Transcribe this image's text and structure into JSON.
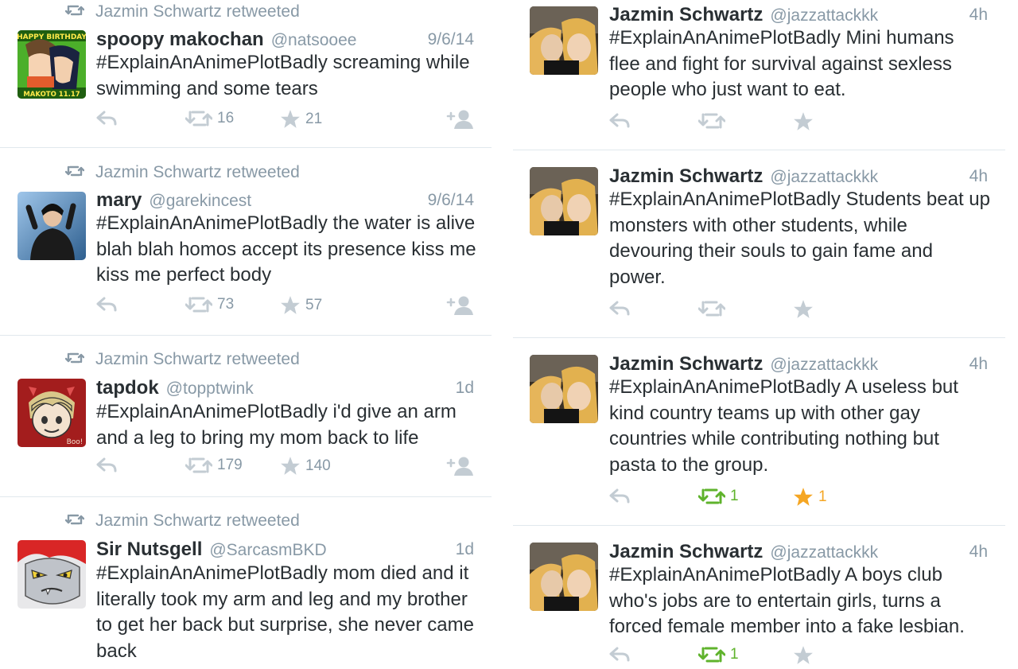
{
  "left_tweets": [
    {
      "retweeted_by": "Jazmin Schwartz retweeted",
      "name": "spoopy makochan",
      "handle": "@natsooee",
      "time": "9/6/14",
      "text": "#ExplainAnAnimePlotBadly screaming while swimming and some tears",
      "retweets": "16",
      "favorites": "21",
      "avatar_icon": "anime-avatar-happy-birthday-icon",
      "avatar_top_text": "HAPPY BIRTHDAY",
      "avatar_bottom_text": "MAKOTO 11.17"
    },
    {
      "retweeted_by": "Jazmin Schwartz retweeted",
      "name": "mary",
      "handle": "@garekincest",
      "time": "9/6/14",
      "text": "#ExplainAnAnimePlotBadly the water is alive blah blah homos accept its presence kiss me kiss me perfect body",
      "retweets": "73",
      "favorites": "57",
      "avatar_icon": "person-photo-avatar-icon"
    },
    {
      "retweeted_by": "Jazmin Schwartz retweeted",
      "name": "tapdok",
      "handle": "@topptwink",
      "time": "1d",
      "text": "#ExplainAnAnimePlotBadly i'd give an arm and a leg to bring my mom back to life",
      "retweets": "179",
      "favorites": "140",
      "avatar_icon": "cartoon-boy-avatar-icon",
      "avatar_text": "Boo!"
    },
    {
      "retweeted_by": "Jazmin Schwartz retweeted",
      "name": "Sir Nutsgell",
      "handle": "@SarcasmBKD",
      "time": "1d",
      "text": "#ExplainAnAnimePlotBadly mom died and it literally took my arm and leg and my brother to get her back but surprise, she never came back",
      "avatar_icon": "red-cartoon-character-avatar-icon"
    }
  ],
  "right_tweets": [
    {
      "name": "Jazmin Schwartz",
      "handle": "@jazzattackkk",
      "time": "4h",
      "text": "#ExplainAnAnimePlotBadly Mini humans flee and fight for survival against sexless people who just want to eat.",
      "retweets": "",
      "favorites": "",
      "retweeted": false,
      "favorited": false,
      "avatar_icon": "selfie-photo-avatar-icon"
    },
    {
      "name": "Jazmin Schwartz",
      "handle": "@jazzattackkk",
      "time": "4h",
      "text": "#ExplainAnAnimePlotBadly Students beat up monsters with other students, while devouring their souls to gain fame and power.",
      "retweets": "",
      "favorites": "",
      "retweeted": false,
      "favorited": false,
      "avatar_icon": "selfie-photo-avatar-icon"
    },
    {
      "name": "Jazmin Schwartz",
      "handle": "@jazzattackkk",
      "time": "4h",
      "text": "#ExplainAnAnimePlotBadly A useless but kind country teams up with other gay countries while contributing nothing but pasta to the group.",
      "retweets": "1",
      "favorites": "1",
      "retweeted": true,
      "favorited": true,
      "avatar_icon": "selfie-photo-avatar-icon"
    },
    {
      "name": "Jazmin Schwartz",
      "handle": "@jazzattackkk",
      "time": "4h",
      "text": "#ExplainAnAnimePlotBadly A boys club who's jobs are to entertain girls, turns a forced female member into a fake lesbian.",
      "retweets": "1",
      "favorites": "",
      "retweeted": true,
      "favorited": false,
      "avatar_icon": "selfie-photo-avatar-icon"
    }
  ],
  "colors": {
    "muted_gray": "#8899a6",
    "text": "#292f33",
    "divider": "#e1e8ed",
    "retweet_green": "#5fb32c",
    "favorite_orange": "#f5a623",
    "icon_gray": "#c3ccd3"
  }
}
